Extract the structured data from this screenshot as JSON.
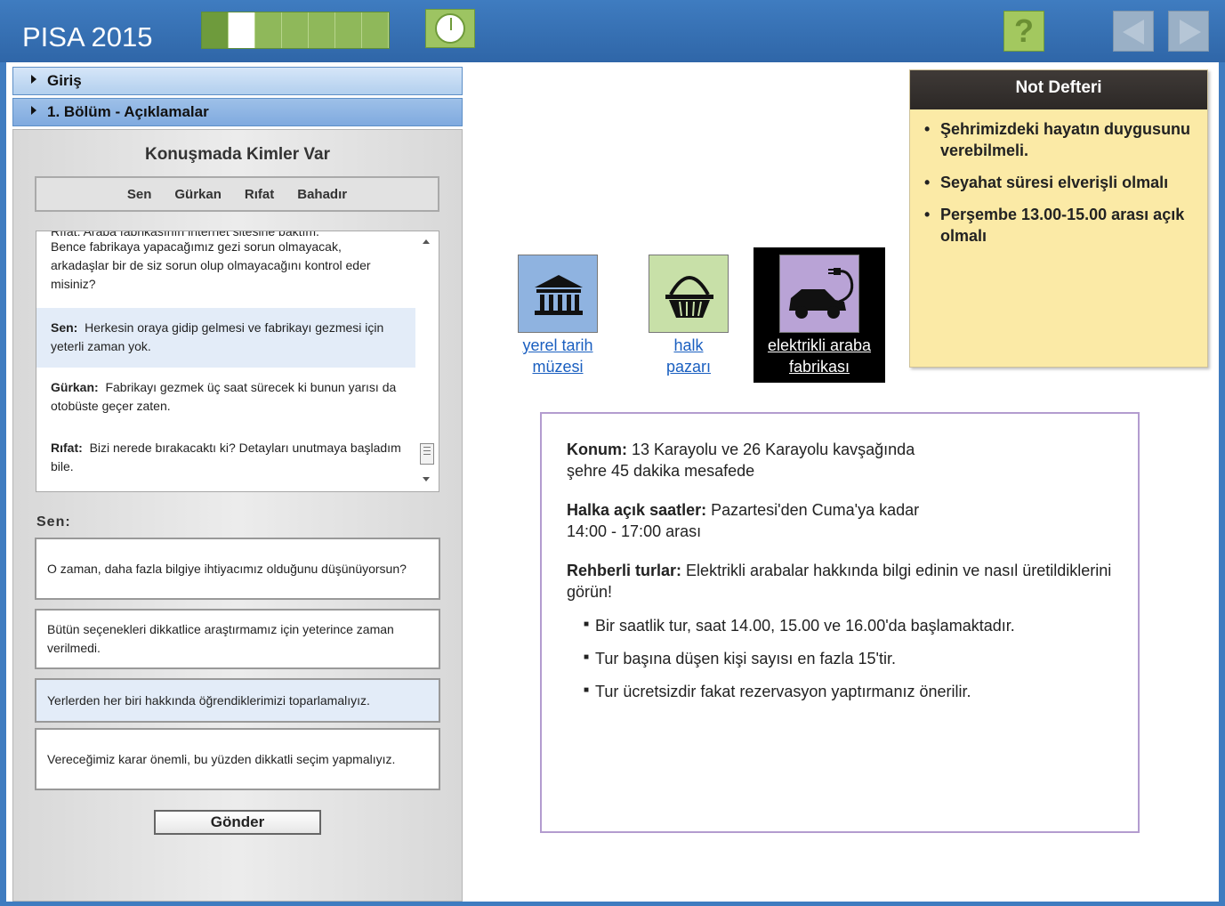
{
  "header": {
    "title": "PISA 2015",
    "help_label": "?"
  },
  "accordion": [
    {
      "label": "Giriş"
    },
    {
      "label": "1. Bölüm - Açıklamalar"
    }
  ],
  "panel": {
    "title": "Konuşmada Kimler Var",
    "participants": [
      "Sen",
      "Gürkan",
      "Rıfat",
      "Bahadır"
    ],
    "chat_cut_line": "Rıfat:  Araba fabrikasının internet sitesine baktım.",
    "messages": [
      {
        "speaker": "",
        "text": "Bence fabrikaya yapacağımız gezi sorun olmayacak, arkadaşlar bir de siz sorun olup olmayacağını kontrol eder misiniz?"
      },
      {
        "speaker": "Sen:",
        "text": "Herkesin oraya gidip gelmesi ve fabrikayı gezmesi için yeterli zaman yok."
      },
      {
        "speaker": "Gürkan:",
        "text": "Fabrikayı gezmek üç saat sürecek ki bunun yarısı da otobüste geçer zaten."
      },
      {
        "speaker": "Rıfat:",
        "text": "Bizi nerede bırakacaktı ki? Detayları unutmaya başladım bile."
      }
    ],
    "reply_label": "Sen:",
    "options": [
      "O zaman, daha fazla bilgiye ihtiyacımız olduğunu düşünüyorsun?",
      "Bütün seçenekleri dikkatlice araştırmamız için yeterince zaman verilmedi.",
      "Yerlerden her biri hakkında öğrendiklerimizi toparlamalıyız.",
      "Vereceğimiz karar önemli, bu yüzden dikkatli seçim yapmalıyız."
    ],
    "send_label": "Gönder"
  },
  "places": [
    {
      "line1": "yerel tarih",
      "line2": "müzesi",
      "icon": "museum-icon"
    },
    {
      "line1": "halk",
      "line2": "pazarı",
      "icon": "basket-icon"
    },
    {
      "line1": "elektrikli araba",
      "line2": "fabrikası",
      "icon": "electric-car-icon"
    }
  ],
  "info": {
    "location_label": "Konum:",
    "location_text": "13 Karayolu ve 26 Karayolu kavşağında",
    "location_text2": "şehre 45 dakika mesafede",
    "hours_label": "Halka açık saatler:",
    "hours_text": "Pazartesi'den Cuma'ya kadar",
    "hours_text2": "14:00 - 17:00 arası",
    "tours_label": "Rehberli turlar:",
    "tours_text": "Elektrikli arabalar hakkında bilgi edinin ve nasıl üretildiklerini görün!",
    "bullets": [
      "Bir saatlik tur, saat 14.00, 15.00 ve 16.00'da başlamaktadır.",
      "Tur başına düşen kişi sayısı en fazla 15'tir.",
      "Tur ücretsizdir fakat rezervasyon yaptırmanız önerilir."
    ]
  },
  "notebook": {
    "title": "Not Defteri",
    "items": [
      "Şehrimizdeki hayatın duygusunu verebilmeli.",
      "Seyahat süresi elverişli olmalı",
      "Perşembe 13.00-15.00 arası açık olmalı"
    ]
  },
  "colors": {
    "header_blue": "#3f7cc0",
    "green": "#9dc462",
    "link": "#1a5fc0",
    "note_yellow": "#fbeaa6"
  }
}
